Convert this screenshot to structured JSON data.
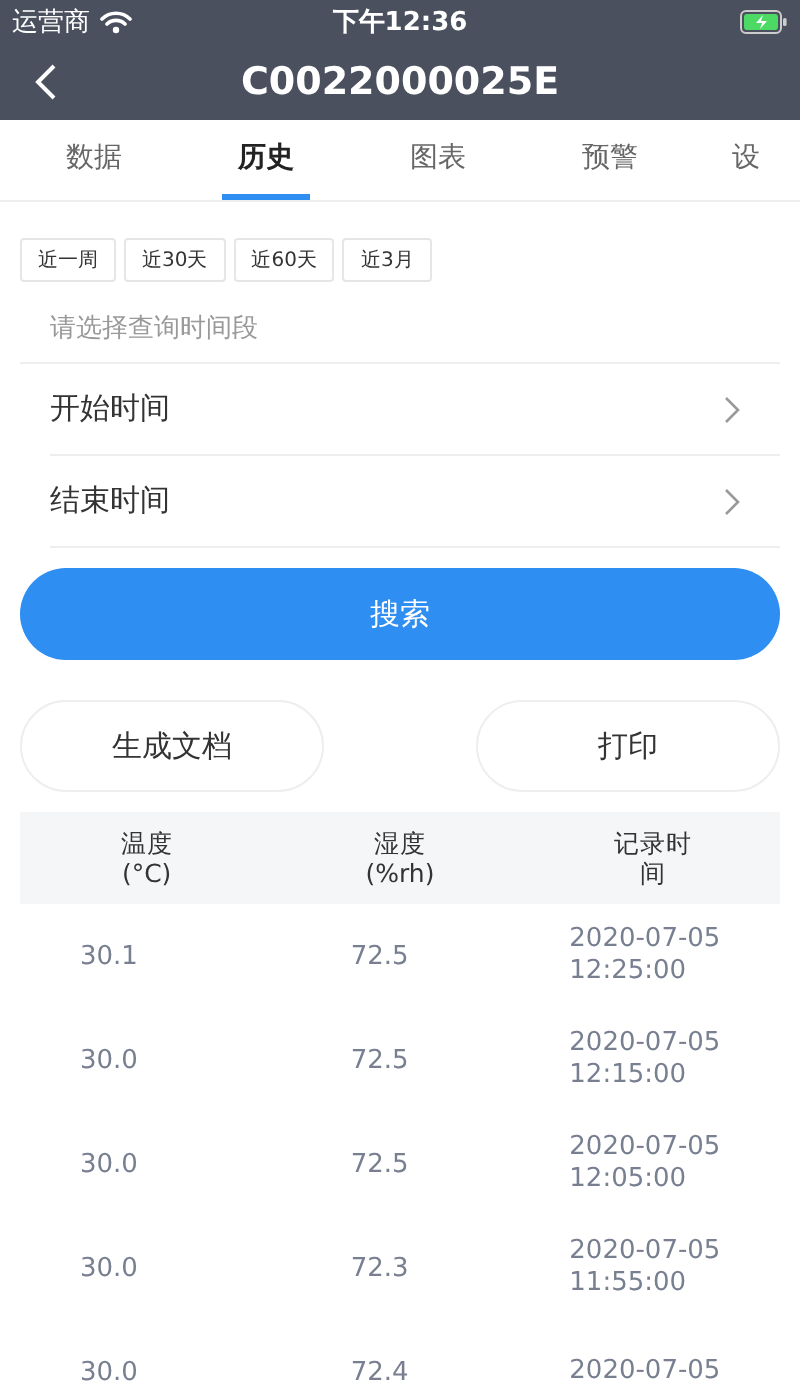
{
  "status_bar": {
    "carrier": "运营商",
    "time": "下午12:36"
  },
  "nav": {
    "title": "C0022000025E"
  },
  "tabs": [
    {
      "label": "数据",
      "selected": false
    },
    {
      "label": "历史",
      "selected": true
    },
    {
      "label": "图表",
      "selected": false
    },
    {
      "label": "预警",
      "selected": false
    },
    {
      "label": "设",
      "selected": false
    }
  ],
  "quick_ranges": [
    "近一周",
    "近30天",
    "近60天",
    "近3月"
  ],
  "range": {
    "placeholder": "请选择查询时间段",
    "rows": [
      {
        "label": "开始时间"
      },
      {
        "label": "结束时间"
      }
    ]
  },
  "search_button": "搜索",
  "actions": [
    "生成文档",
    "打印"
  ],
  "table": {
    "columns": [
      "温度 (°C)",
      "湿度 (%rh)",
      "记录时间"
    ],
    "rows": [
      [
        "30.1",
        "72.5",
        "2020-07-05 12:25:00"
      ],
      [
        "30.0",
        "72.5",
        "2020-07-05 12:15:00"
      ],
      [
        "30.0",
        "72.5",
        "2020-07-05 12:05:00"
      ],
      [
        "30.0",
        "72.3",
        "2020-07-05 11:55:00"
      ],
      [
        "30.0",
        "72.4",
        "2020-07-05"
      ]
    ]
  }
}
